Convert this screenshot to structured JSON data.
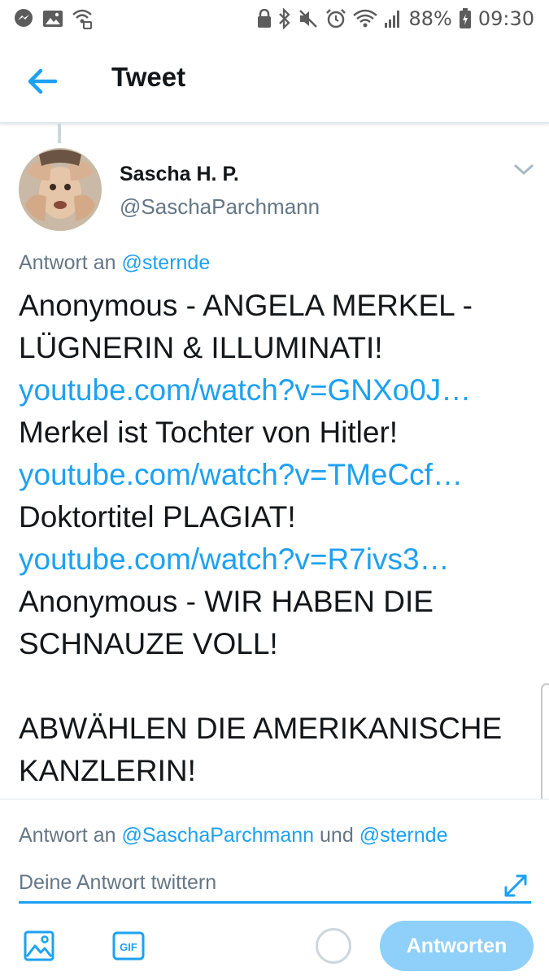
{
  "status_bar": {
    "battery": "88%",
    "time": "09:30",
    "icons_left": [
      "messenger-icon",
      "gallery-icon",
      "wifi-calling-icon"
    ],
    "icons_right": [
      "lock-icon",
      "bluetooth-icon",
      "mute-icon",
      "alarm-icon",
      "wifi-icon",
      "signal-icon",
      "battery-icon"
    ]
  },
  "header": {
    "title": "Tweet",
    "back_icon": "arrow-left-icon"
  },
  "tweet": {
    "author_name": "Sascha H. P.",
    "author_handle": "@SaschaParchmann",
    "reply_prefix": "Antwort an",
    "reply_mention": "@sternde",
    "lines": [
      "Anonymous - ANGELA MERKEL -",
      "LÜGNERIN & ILLUMINATI!",
      "youtube.com/watch?v=GNXo0J…",
      "Merkel ist Tochter von Hitler!",
      "youtube.com/watch?v=TMeCcf…",
      "Doktortitel PLAGIAT!",
      "youtube.com/watch?v=R7ivs3…",
      "Anonymous - WIR HABEN DIE",
      "SCHNAUZE VOLL!",
      "ABWÄHLEN DIE AMERIKANISCHE",
      "KANZLERIN!"
    ]
  },
  "composer": {
    "context_prefix": "Antwort an",
    "context_mention1": "@SaschaParchmann",
    "context_and": "und",
    "context_mention2": "@sternde",
    "placeholder": "Deine Antwort twittern",
    "send_label": "Antworten",
    "gif_label": "GIF"
  },
  "colors": {
    "link": "#1da1f2",
    "send_button": "#8ed0f9",
    "secondary_text": "#657786"
  }
}
